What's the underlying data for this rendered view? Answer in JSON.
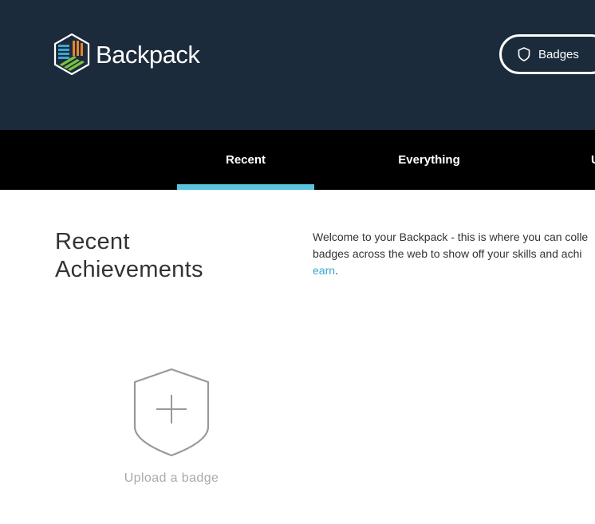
{
  "header": {
    "logo_text": "Backpack",
    "logo_icon": "backpack-hexagon-logo",
    "badges_button": {
      "label": "Badges",
      "icon": "shield-icon"
    }
  },
  "tabs": [
    {
      "label": "Recent",
      "active": true
    },
    {
      "label": "Everything",
      "active": false
    },
    {
      "label": "U",
      "active": false
    }
  ],
  "main": {
    "title_line1": "Recent",
    "title_line2": "Achievements",
    "welcome_line1": "Welcome to your Backpack - this is where you can colle",
    "welcome_line2": "badges across the web to show off your skills and achi",
    "welcome_link": "earn",
    "welcome_end": "."
  },
  "upload": {
    "label": "Upload a badge",
    "icon": "shield-plus-icon"
  },
  "colors": {
    "header_bg": "#1c2b3b",
    "tabbar_bg": "#000000",
    "active_tab_indicator": "#5ac3e0",
    "link": "#3aa6d0"
  }
}
